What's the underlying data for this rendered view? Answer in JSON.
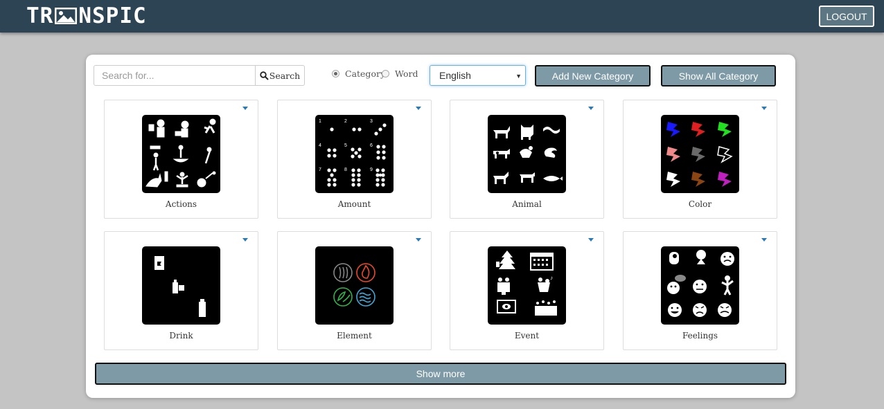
{
  "header": {
    "logo_part1": "TR",
    "logo_part2": "NSPIC",
    "logout_label": "LOGOUT"
  },
  "search": {
    "placeholder": "Search for...",
    "value": "",
    "button_label": "Search"
  },
  "filter": {
    "options": [
      {
        "label": "Category",
        "selected": true
      },
      {
        "label": "Word",
        "selected": false
      }
    ]
  },
  "language": {
    "selected": "English"
  },
  "actions": {
    "add_label": "Add New Category",
    "show_all_label": "Show All Category"
  },
  "categories": [
    {
      "name": "Actions",
      "icon": "actions-collage"
    },
    {
      "name": "Amount",
      "icon": "dice-numbers-collage"
    },
    {
      "name": "Animal",
      "icon": "animals-collage"
    },
    {
      "name": "Color",
      "icon": "color-swatches-collage"
    },
    {
      "name": "Drink",
      "icon": "drinks-collage"
    },
    {
      "name": "Element",
      "icon": "four-elements-collage"
    },
    {
      "name": "Event",
      "icon": "events-collage"
    },
    {
      "name": "Feelings",
      "icon": "faces-collage"
    }
  ],
  "footer": {
    "show_more_label": "Show more"
  },
  "colors": {
    "navbar": "#2c4453",
    "button": "#7d9aa6",
    "accent": "#2a7ab7"
  }
}
